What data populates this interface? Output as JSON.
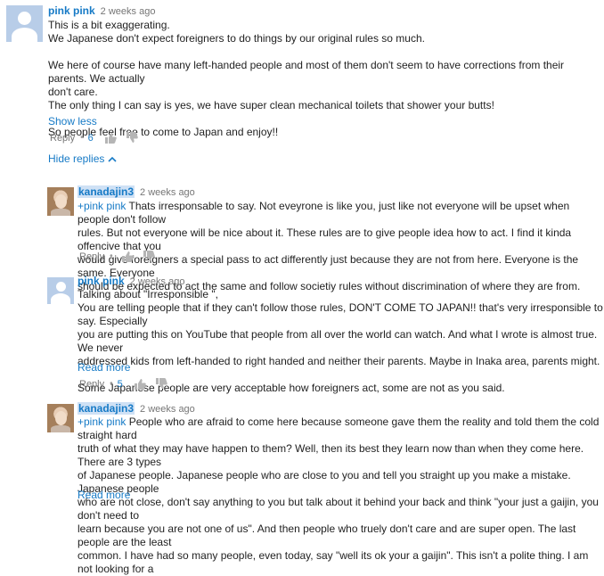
{
  "comments": [
    {
      "author": "pink pink",
      "time": "2 weeks ago",
      "lines": [
        "This is a bit exaggerating.",
        "We Japanese don't expect foreigners to do things by our original rules so much.",
        "",
        "We here of course have many left-handed people and most of them don't seem to have corrections from their parents. We actually",
        "don't care.",
        "The only thing I can say is yes, we have super clean mechanical toilets that shower your butts!",
        "",
        "So people feel free to come to Japan and enjoy!!"
      ],
      "toggle_label": "Show less",
      "reply_label": "Reply",
      "likes": "6"
    }
  ],
  "hide_replies_label": "Hide replies",
  "replies": [
    {
      "author": "kanadajin3",
      "time": "2 weeks ago",
      "mention": "+pink pink",
      "lines": [
        " Thats irresponsable to say.  Not eveyrone is like you, just like not everyone will be upset when people don't follow",
        "rules. But not everyone will be nice about it. These rules are to give people idea how to act.  I find it kinda offencive that you",
        "would give foreigners a special pass to act differently just because they are not from here. Everyone is the same. Everyone",
        "should be expected to act the same and follow societiy rules without discrimination of where they are from."
      ],
      "reply_label": "Reply"
    },
    {
      "author": "pink pink",
      "time": "2 weeks ago",
      "lines": [
        "Talking about \"Irresponsible \",",
        "You are telling people that if they can't follow those rules, DON'T COME TO JAPAN!! that's very irresponsible to say. Especially",
        "you are putting this on YouTube that people from all over the world can watch. And what I wrote is almost true. We never",
        "addressed kids from left-handed to right handed and neither their parents. Maybe in Inaka area, parents might.",
        "",
        "Some Japanese people are very acceptable how foreigners act, some are not as you said."
      ],
      "toggle_label": "Read more",
      "reply_label": "Reply",
      "likes": "5"
    },
    {
      "author": "kanadajin3",
      "time": "2 weeks ago",
      "mention": "+pink pink",
      "lines": [
        " People who are afraid to come here because someone gave them the reality and told them the cold straight hard",
        "truth of what they may have happen to them? Well, then its best they learn now than when they come here.   There are 3 types",
        "of Japanese people.  Japanese people who are close to you and tell you straight up you make a mistake. Japanese people",
        "who are not close, don't say anything to you but talk about it behind your back and think \"your just a gaijin, you don't need to",
        "learn because you are not one of us\". And then people who truely don't care and are super open. The last people are the least",
        "common.  I have had so many people, even today, say \"well its ok your a gaijin\".  This isn't a polite thing. I am not looking for a"
      ],
      "toggle_label": "Read more"
    }
  ],
  "colors": {
    "link": "#167ac6",
    "meta": "#767676",
    "avatar_bg": "#b8cde8"
  },
  "icons": {
    "like": "thumbs-up-icon",
    "dislike": "thumbs-down-icon",
    "chevron": "chevron-up-icon"
  }
}
